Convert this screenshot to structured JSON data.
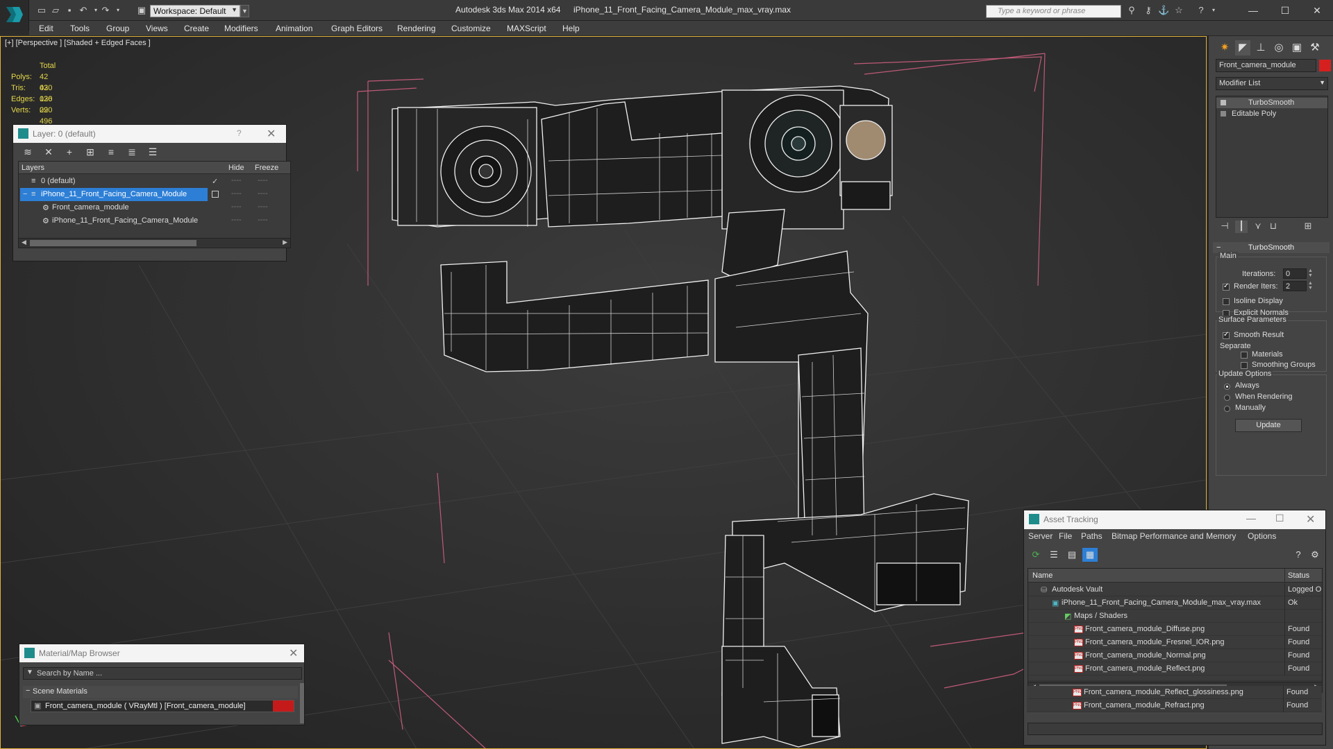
{
  "titlebar": {
    "workspace_value": "Workspace: Default",
    "app_title": "Autodesk 3ds Max  2014 x64",
    "file_title": "iPhone_11_Front_Facing_Camera_Module_max_vray.max",
    "search_placeholder": "Type a keyword or phrase"
  },
  "menu": [
    "Edit",
    "Tools",
    "Group",
    "Views",
    "Create",
    "Modifiers",
    "Animation",
    "Graph Editors",
    "Rendering",
    "Customize",
    "MAXScript",
    "Help"
  ],
  "viewport": {
    "label": "[+] [Perspective ] [Shaded + Edged Faces ]",
    "stats": {
      "total_label": "Total",
      "rows": [
        {
          "k": "Polys:",
          "v": "42 030"
        },
        {
          "k": "Tris:",
          "v": "42 030"
        },
        {
          "k": "Edges:",
          "v": "126 090"
        },
        {
          "k": "Verts:",
          "v": "22 496"
        }
      ]
    }
  },
  "layer_window": {
    "title": "Layer: 0 (default)",
    "help": "?",
    "columns": {
      "layers": "Layers",
      "hide": "Hide",
      "freeze": "Freeze"
    },
    "rows": [
      {
        "name": "0 (default)"
      },
      {
        "name": "iPhone_11_Front_Facing_Camera_Module"
      },
      {
        "name": "Front_camera_module"
      },
      {
        "name": "iPhone_11_Front_Facing_Camera_Module"
      }
    ],
    "dash": "----"
  },
  "material_browser": {
    "title": "Material/Map Browser",
    "search_placeholder": "Search by Name ...",
    "section": "Scene Materials",
    "item": "Front_camera_module  ( VRayMtl ) [Front_camera_module]"
  },
  "command_panel": {
    "object_name": "Front_camera_module",
    "modifier_list": "Modifier List",
    "stack": [
      "TurboSmooth",
      "Editable Poly"
    ],
    "rollout_title": "TurboSmooth",
    "main_group": "Main",
    "iterations_label": "Iterations:",
    "iterations_value": "0",
    "render_iters_label": "Render Iters:",
    "render_iters_value": "2",
    "isoline_label": "Isoline Display",
    "explicit_normals_label": "Explicit Normals",
    "surface_group": "Surface Parameters",
    "smooth_result_label": "Smooth Result",
    "separate_label": "Separate",
    "materials_label": "Materials",
    "smoothing_groups_label": "Smoothing Groups",
    "update_group": "Update Options",
    "always_label": "Always",
    "when_rendering_label": "When Rendering",
    "manually_label": "Manually",
    "update_button": "Update"
  },
  "asset_tracking": {
    "title": "Asset Tracking",
    "menu": [
      "Server",
      "File",
      "Paths",
      "Bitmap Performance and Memory",
      "Options"
    ],
    "columns": {
      "name": "Name",
      "status": "Status"
    },
    "rows": [
      {
        "name": "Autodesk Vault",
        "status": "Logged O"
      },
      {
        "name": "iPhone_11_Front_Facing_Camera_Module_max_vray.max",
        "status": "Ok"
      },
      {
        "name": "Maps / Shaders",
        "status": ""
      },
      {
        "name": "Front_camera_module_Diffuse.png",
        "status": "Found"
      },
      {
        "name": "Front_camera_module_Fresnel_IOR.png",
        "status": "Found"
      },
      {
        "name": "Front_camera_module_Normal.png",
        "status": "Found"
      },
      {
        "name": "Front_camera_module_Reflect.png",
        "status": "Found"
      },
      {
        "name": "Front_camera_module_Reflect_glossiness.png",
        "status": "Found"
      },
      {
        "name": "Front_camera_module_Refract.png",
        "status": "Found"
      }
    ]
  },
  "colors": {
    "selection": "#2d7fd6",
    "stats_text": "#e6d84a",
    "object_color": "#d62020"
  }
}
